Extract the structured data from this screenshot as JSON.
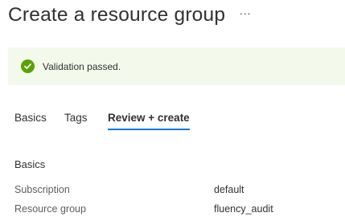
{
  "header": {
    "title": "Create a resource group",
    "more_label": "···"
  },
  "validation": {
    "message": "Validation passed.",
    "status_color": "#57a300",
    "background_color": "#f3faec"
  },
  "tabs": [
    {
      "label": "Basics",
      "active": false
    },
    {
      "label": "Tags",
      "active": false
    },
    {
      "label": "Review + create",
      "active": true
    }
  ],
  "accent_color": "#0078d4",
  "summary": {
    "section_title": "Basics",
    "rows": [
      {
        "label": "Subscription",
        "value": "default"
      },
      {
        "label": "Resource group",
        "value": "fluency_audit"
      }
    ]
  }
}
